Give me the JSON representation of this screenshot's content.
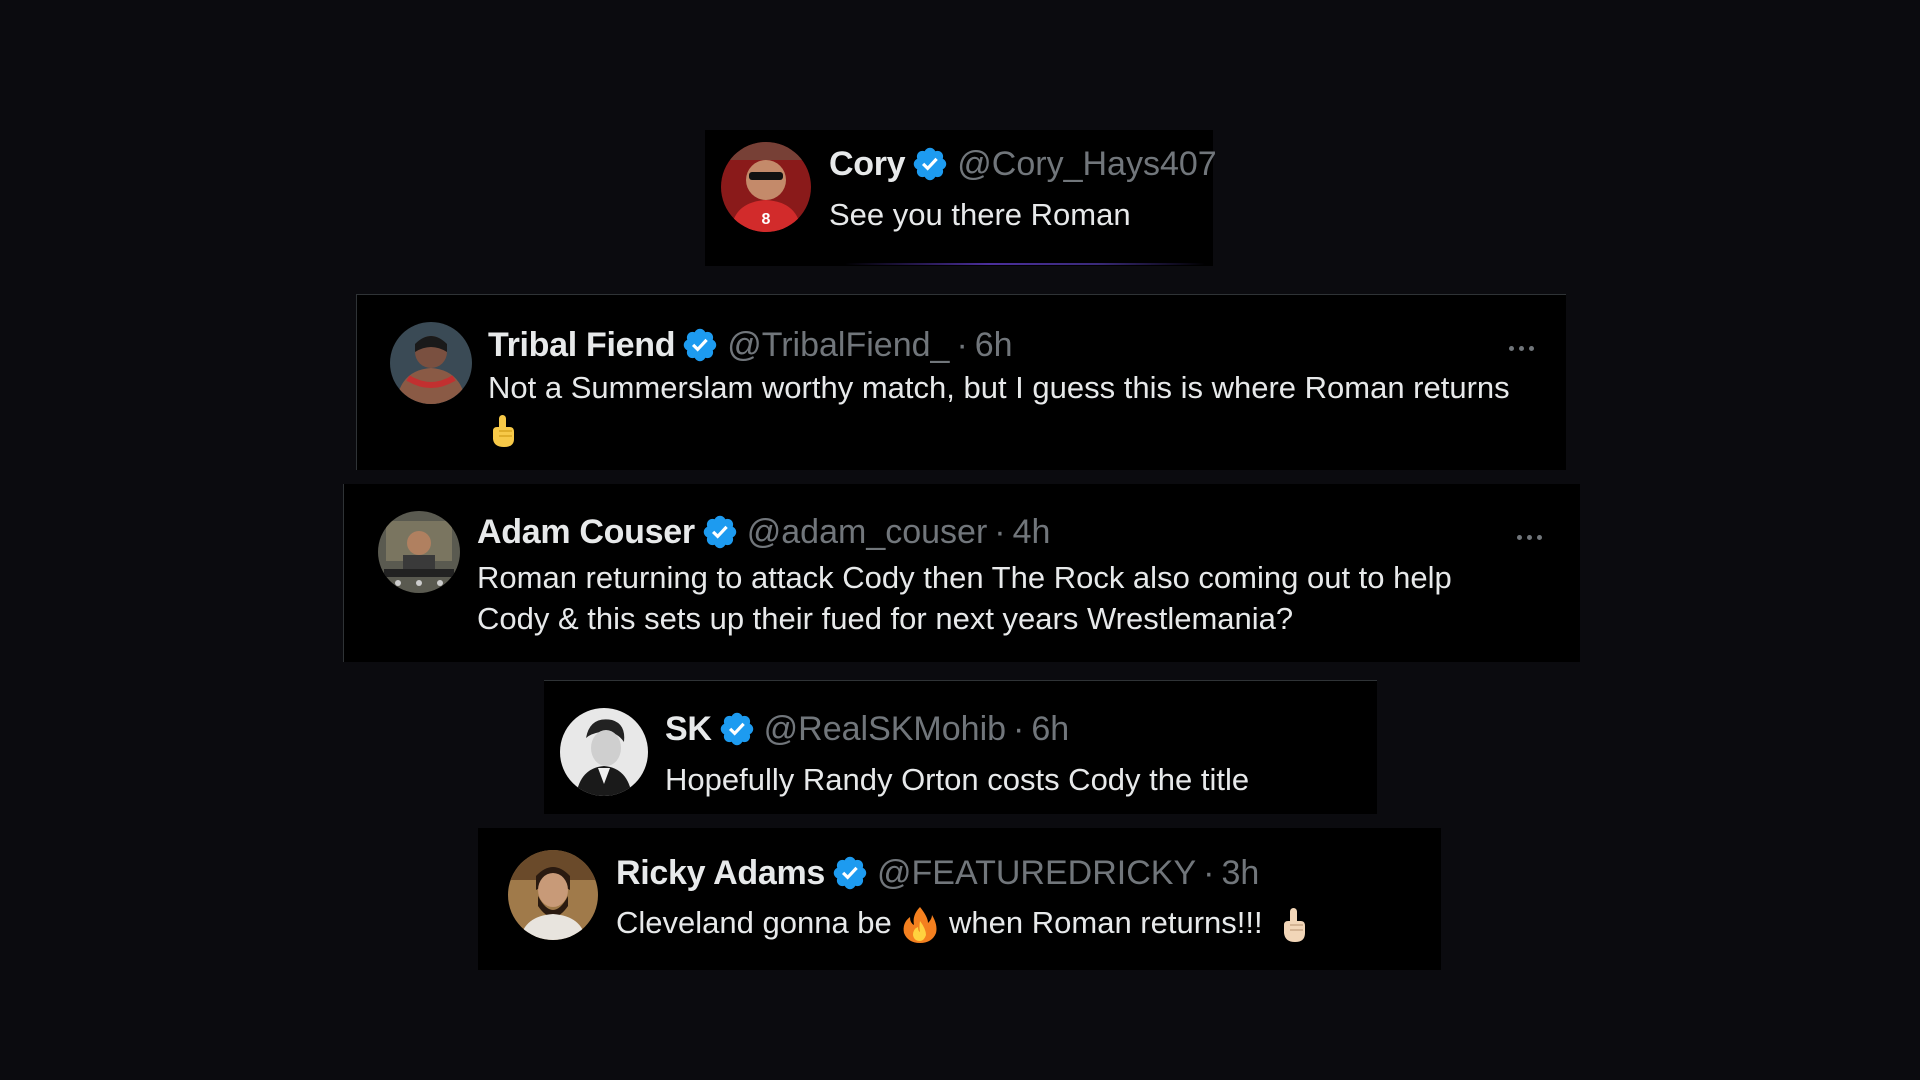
{
  "tweets": [
    {
      "name": "Cory",
      "handle": "@Cory_Hays407",
      "time": "",
      "text": "See you there Roman",
      "avatar_icon": "avatar-red-jersey-sunglasses"
    },
    {
      "name": "Tribal Fiend",
      "handle": "@TribalFiend_",
      "time": "6h",
      "text": "Not a Summerslam worthy match, but I guess this is where Roman returns",
      "emoji": "index-pointing-up-emoji",
      "avatar_icon": "avatar-wrestler-lei"
    },
    {
      "name": "Adam Couser",
      "handle": "@adam_couser",
      "time": "4h",
      "text_line1": "Roman returning to attack Cody then The Rock also coming out to help",
      "text_line2": "Cody & this sets up their fued for next years Wrestlemania?",
      "avatar_icon": "avatar-gym"
    },
    {
      "name": "SK",
      "handle": "@RealSKMohib",
      "time": "6h",
      "text": "Hopefully Randy Orton costs Cody the title",
      "avatar_icon": "avatar-bw-portrait"
    },
    {
      "name": "Ricky Adams",
      "handle": "@FEATUREDRICKY",
      "time": "3h",
      "text_before": "Cleveland gonna be",
      "text_after": "when Roman returns!!!",
      "emoji1": "fire-emoji",
      "emoji2": "index-pointing-up-emoji",
      "avatar_icon": "avatar-bearded-man"
    }
  ],
  "colors": {
    "verified": "#1d9bf0",
    "muted": "#71767b",
    "text": "#e7e9ea",
    "background": "#0b0b0f",
    "card": "#000000"
  },
  "separator": "·"
}
